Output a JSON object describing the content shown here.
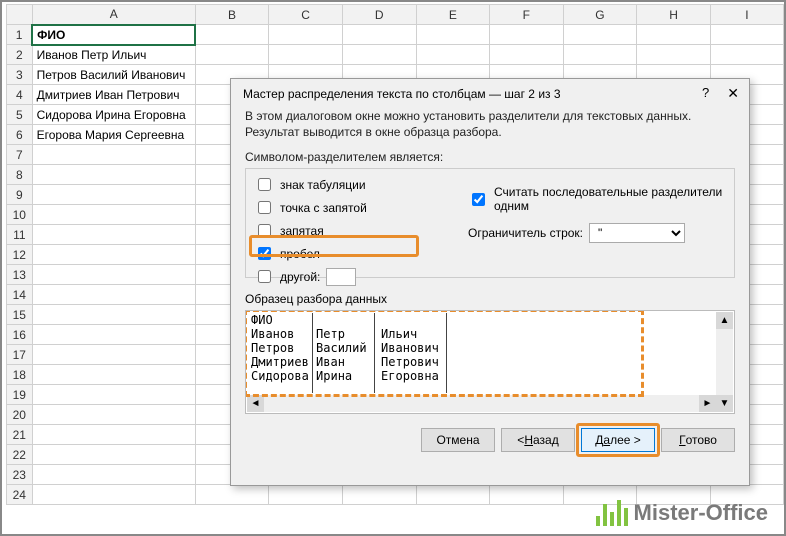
{
  "sheet": {
    "columns": [
      "A",
      "B",
      "C",
      "D",
      "E",
      "F",
      "G",
      "H",
      "I"
    ],
    "rows": [
      {
        "n": "1",
        "A": "ФИО"
      },
      {
        "n": "2",
        "A": "Иванов Петр Ильич"
      },
      {
        "n": "3",
        "A": "Петров Василий Иванович"
      },
      {
        "n": "4",
        "A": "Дмитриев Иван Петрович"
      },
      {
        "n": "5",
        "A": "Сидорова Ирина Егоровна"
      },
      {
        "n": "6",
        "A": "Егорова Мария Сергеевна"
      },
      {
        "n": "7",
        "A": ""
      },
      {
        "n": "8",
        "A": ""
      },
      {
        "n": "9",
        "A": ""
      },
      {
        "n": "10",
        "A": ""
      },
      {
        "n": "11",
        "A": ""
      },
      {
        "n": "12",
        "A": ""
      },
      {
        "n": "13",
        "A": ""
      },
      {
        "n": "14",
        "A": ""
      },
      {
        "n": "15",
        "A": ""
      },
      {
        "n": "16",
        "A": ""
      },
      {
        "n": "17",
        "A": ""
      },
      {
        "n": "18",
        "A": ""
      },
      {
        "n": "19",
        "A": ""
      },
      {
        "n": "20",
        "A": ""
      },
      {
        "n": "21",
        "A": ""
      },
      {
        "n": "22",
        "A": ""
      },
      {
        "n": "23",
        "A": ""
      },
      {
        "n": "24",
        "A": ""
      }
    ]
  },
  "dialog": {
    "title": "Мастер распределения текста по столбцам — шаг 2 из 3",
    "help": "?",
    "close": "✕",
    "desc": "В этом диалоговом окне можно установить разделители для текстовых данных. Результат выводится в окне образца разбора.",
    "delim_label": "Символом-разделителем является:",
    "tab": "знак табуляции",
    "semicolon": "точка с запятой",
    "comma": "запятая",
    "space": "пробел",
    "other": "другой:",
    "consecutive": "Считать последовательные разделители одним",
    "qualifier_label": "Ограничитель строк:",
    "qualifier_value": "\"",
    "preview_label": "Образец разбора данных",
    "preview_text": "ФИО\nИванов   Петр     Ильич\nПетров   Василий  Иванович\nДмитриев Иван     Петрович\nСидорова Ирина    Егоровна",
    "btn_cancel": "Отмена",
    "btn_back_u": "Н",
    "btn_back_rest": "азад",
    "btn_back_prefix": "< ",
    "btn_next_u": "а",
    "btn_next_pre": "Д",
    "btn_next_post": "лее >",
    "btn_finish_u": "Г",
    "btn_finish_rest": "отово"
  },
  "logo": {
    "text": "Mister-Office"
  }
}
